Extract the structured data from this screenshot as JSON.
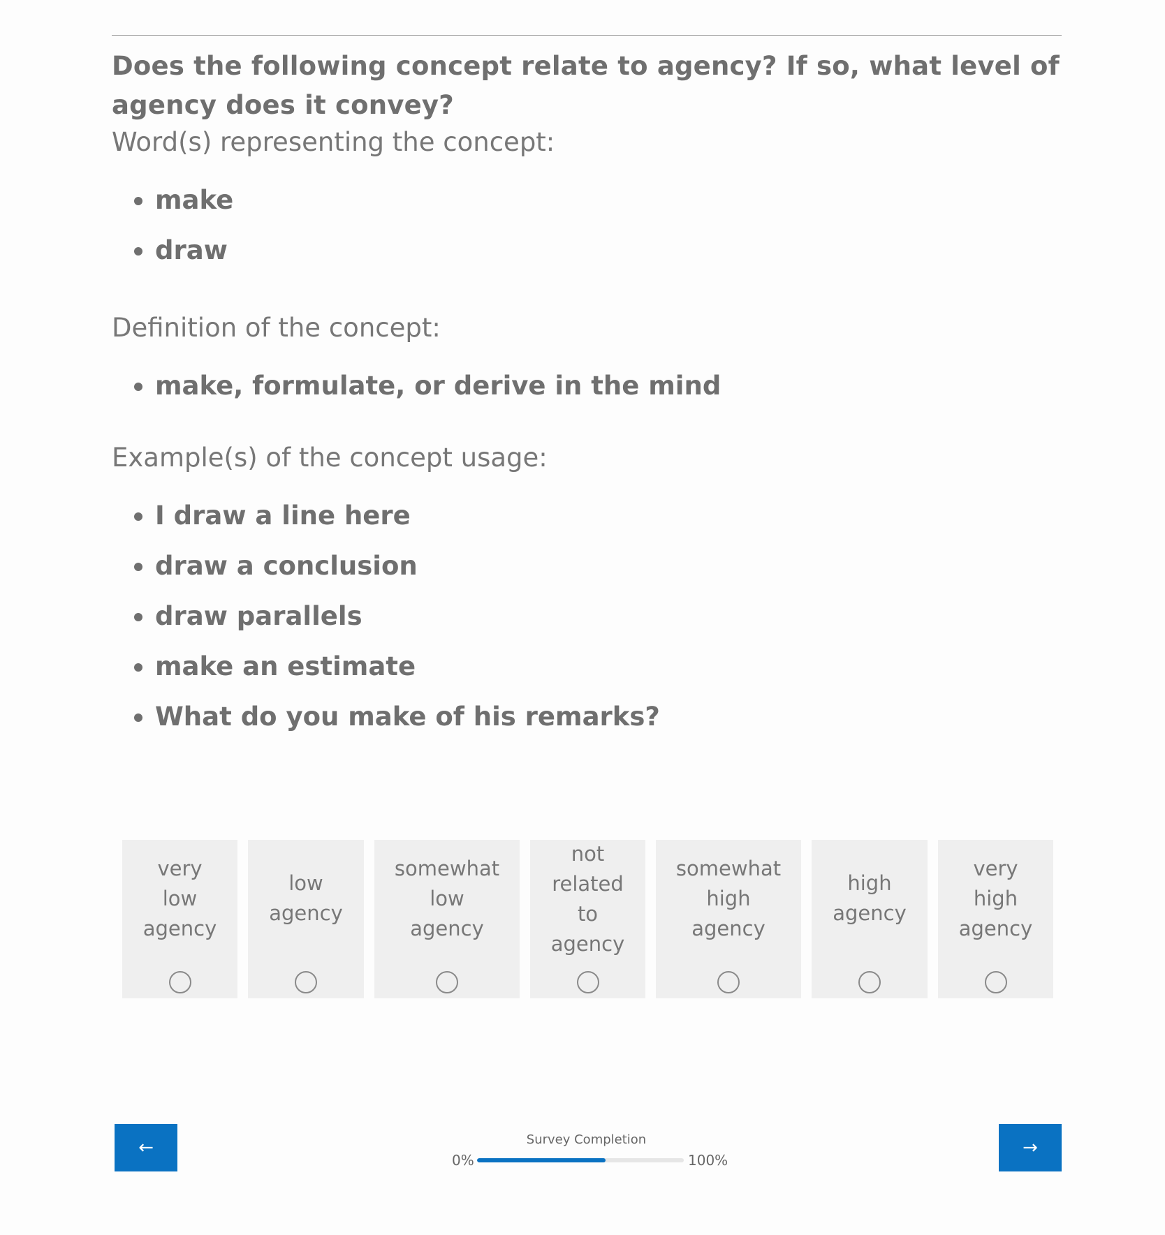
{
  "question": "Does the following concept relate to agency? If so, what level of agency does it convey?",
  "words_label": "Word(s) representing the concept:",
  "words": [
    "make",
    "draw"
  ],
  "definition_label": "Definition of the concept:",
  "definitions": [
    "make, formulate, or derive in the mind"
  ],
  "examples_label": "Example(s) of the concept usage:",
  "examples": [
    "I draw a line here",
    "draw a conclusion",
    "draw parallels",
    "make an estimate",
    "What do you make of his remarks?"
  ],
  "options": [
    {
      "label": [
        "very",
        "low",
        "agency"
      ],
      "selected": false
    },
    {
      "label": [
        "low",
        "agency"
      ],
      "selected": false
    },
    {
      "label": [
        "somewhat",
        "low",
        "agency"
      ],
      "selected": false
    },
    {
      "label": [
        "not",
        "related",
        "to",
        "agency"
      ],
      "selected": false
    },
    {
      "label": [
        "somewhat",
        "high",
        "agency"
      ],
      "selected": false
    },
    {
      "label": [
        "high",
        "agency"
      ],
      "selected": false
    },
    {
      "label": [
        "very",
        "high",
        "agency"
      ],
      "selected": false
    }
  ],
  "nav": {
    "prev_label": "←",
    "next_label": "→"
  },
  "progress": {
    "title": "Survey Completion",
    "min_label": "0%",
    "max_label": "100%",
    "fraction": 0.62
  },
  "colors": {
    "accent": "#0a72c2",
    "text": "#6f6f6f",
    "option_bg": "#efefef"
  }
}
